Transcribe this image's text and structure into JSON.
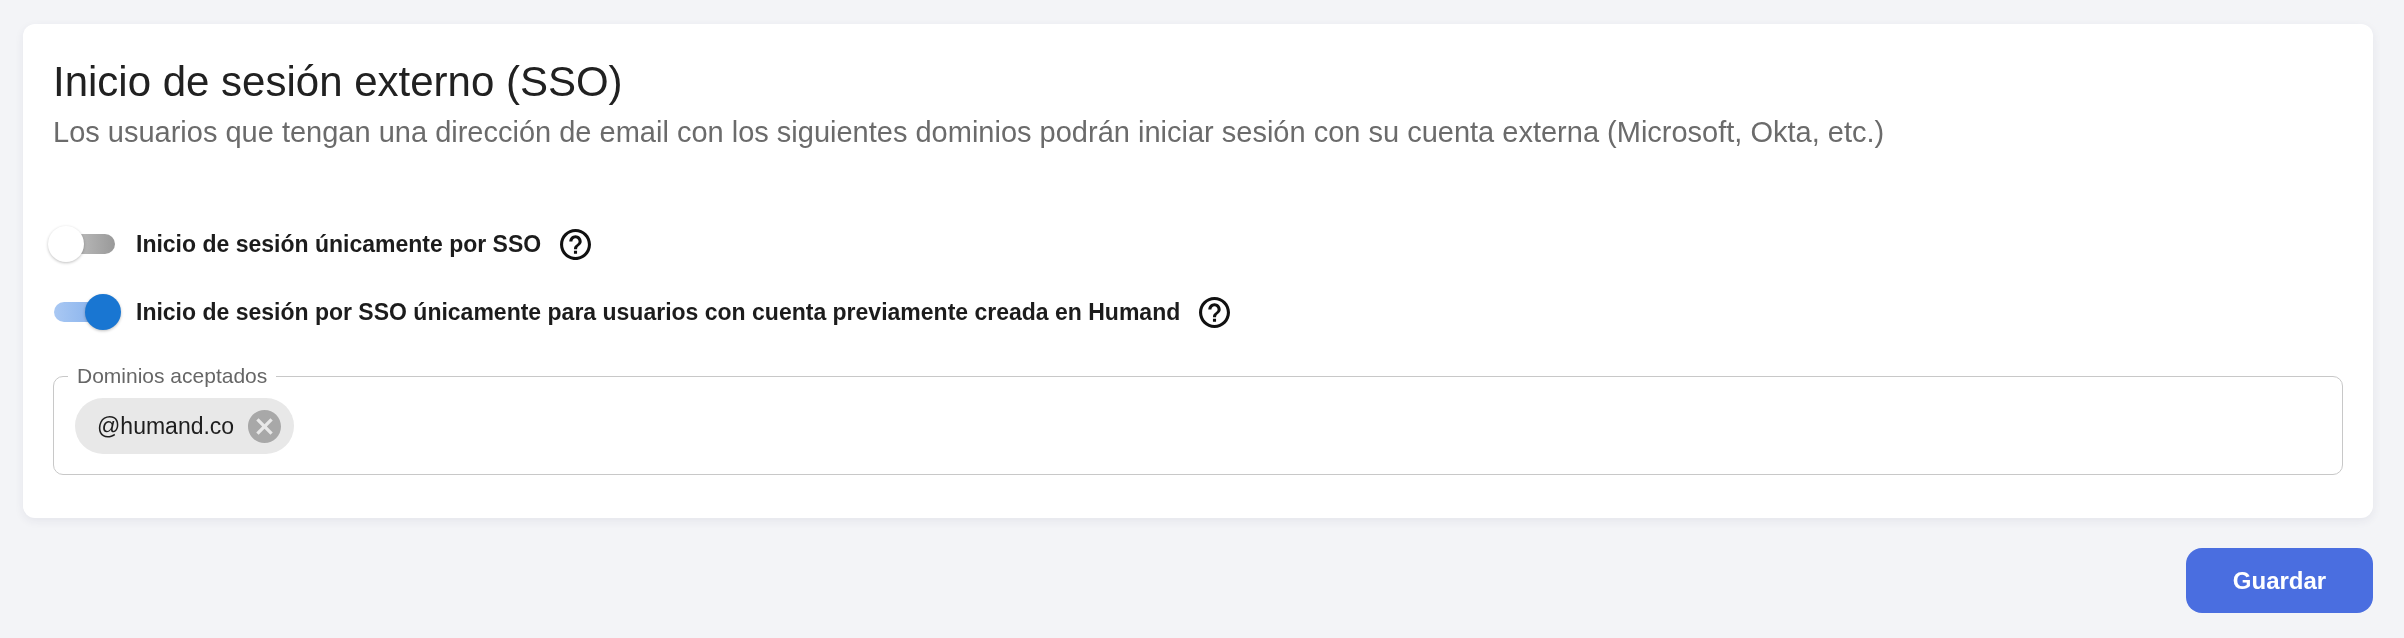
{
  "card": {
    "title": "Inicio de sesión externo (SSO)",
    "description": "Los usuarios que tengan una dirección de email con los siguientes dominios podrán iniciar sesión con su cuenta externa (Microsoft, Okta, etc.)"
  },
  "options": [
    {
      "label": "Inicio de sesión únicamente por SSO",
      "on": false
    },
    {
      "label": "Inicio de sesión por SSO únicamente para usuarios con cuenta previamente creada en Humand",
      "on": true
    }
  ],
  "domains_field": {
    "label": "Dominios aceptados",
    "chips": [
      "@humand.co"
    ]
  },
  "save_button": {
    "label": "Guardar"
  }
}
